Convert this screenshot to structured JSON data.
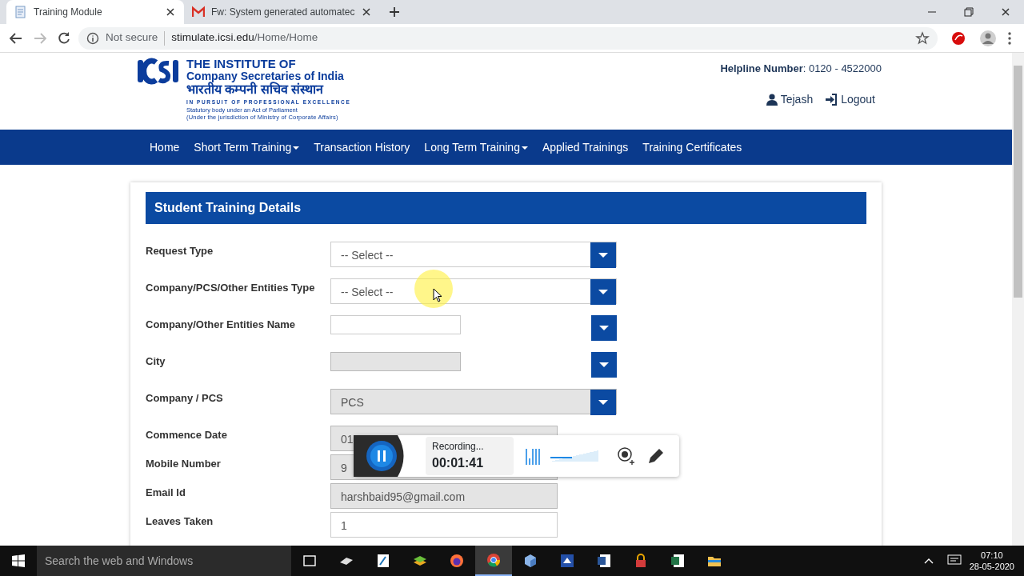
{
  "browser": {
    "tabs": [
      {
        "title": "Training Module",
        "selected": true
      },
      {
        "title": "Fw: System generated automatec",
        "selected": false
      }
    ],
    "security": "Not secure",
    "url_host": "stimulate.icsi.edu",
    "url_path": "/Home/Home"
  },
  "header": {
    "logo_lines": [
      "THE INSTITUTE OF",
      "Company Secretaries of India",
      "भारतीय कम्पनी सचिव संस्थान",
      "IN PURSUIT OF PROFESSIONAL EXCELLENCE",
      "Statutory body under an Act of Parliament",
      "(Under the jurisdiction of Ministry of Corporate Affairs)"
    ],
    "helpline": "**Helpline Number**: 0120 - 4522000",
    "user": "Tejash",
    "logout": "Logout"
  },
  "nav": [
    {
      "label": "Home",
      "dropdown": false
    },
    {
      "label": "Short Term Training",
      "dropdown": true
    },
    {
      "label": "Transaction History",
      "dropdown": false
    },
    {
      "label": "Long Term Training",
      "dropdown": true
    },
    {
      "label": "Applied Trainings",
      "dropdown": false
    },
    {
      "label": "Training Certificates",
      "dropdown": false
    }
  ],
  "panel": {
    "title": "Student Training Details",
    "fields": [
      {
        "label": "Request Type",
        "kind": "select",
        "value": "-- Select --",
        "disabled": false
      },
      {
        "label": "Company/PCS/Other Entities Type",
        "kind": "select",
        "value": "-- Select --",
        "disabled": false
      },
      {
        "label": "Company/Other Entities Name",
        "kind": "combo",
        "disabled": false
      },
      {
        "label": "City",
        "kind": "combo",
        "disabled": true
      },
      {
        "label": "Company / PCS",
        "kind": "select",
        "value": "PCS",
        "disabled": true
      },
      {
        "label": "Commence Date",
        "kind": "input",
        "value": "01",
        "disabled": true
      },
      {
        "label": "Mobile Number",
        "kind": "input",
        "value": "9",
        "disabled": true
      },
      {
        "label": "Email Id",
        "kind": "input",
        "value": "harshbaid95@gmail.com",
        "disabled": true
      },
      {
        "label": "Leaves Taken",
        "kind": "input",
        "value": "1",
        "disabled": false
      }
    ]
  },
  "recorder": {
    "status": "Recording...",
    "time": "00:01:41",
    "level": 0.45
  },
  "taskbar": {
    "search_placeholder": "Search the web and Windows",
    "apps": [
      {
        "selected": false
      },
      {
        "selected": false
      },
      {
        "selected": false
      },
      {
        "selected": false
      },
      {
        "selected": false
      },
      {
        "selected": true
      },
      {
        "selected": false
      },
      {
        "selected": false
      },
      {
        "selected": false
      },
      {
        "selected": false
      },
      {
        "selected": false
      },
      {
        "selected": false
      }
    ],
    "time": "07:10",
    "date": "28-05-2020"
  }
}
